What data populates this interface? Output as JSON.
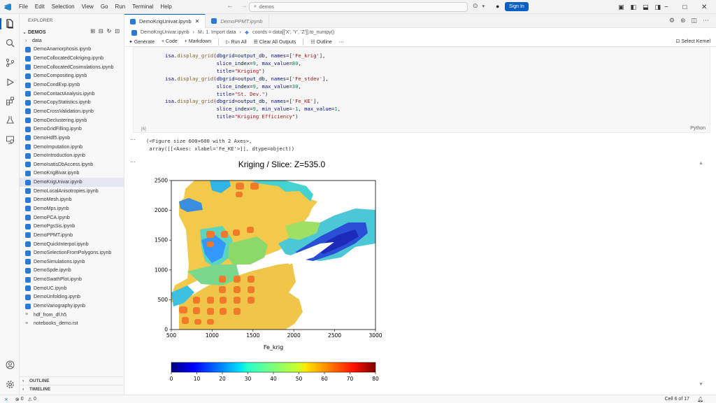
{
  "menu": [
    "File",
    "Edit",
    "Selection",
    "View",
    "Go",
    "Run",
    "Terminal",
    "Help"
  ],
  "search": {
    "text": "demos"
  },
  "account": {
    "sign_in": "Sign In"
  },
  "explorer": {
    "title": "EXPLORER",
    "root": "DEMOS",
    "folders": [
      "data"
    ],
    "notebooks": [
      "DemoAnamorphosis.ipynb",
      "DemoCollocatedCokriging.ipynb",
      "DemoCollocatedCosimulations.ipynb",
      "DemoCompositing.ipynb",
      "DemoCondExp.ipynb",
      "DemoContactAnalysis.ipynb",
      "DemoCopyStatistics.ipynb",
      "DemoCrossValidation.ipynb",
      "DemoDeclustering.ipynb",
      "DemoGridFilling.ipynb",
      "DemoHdf5.ipynb",
      "DemoImputation.ipynb",
      "DemoIntroduction.ipynb",
      "DemoIsatisDbAccess.ipynb",
      "DemoKrigBivar.ipynb",
      "DemoKrigUnivar.ipynb",
      "DemoLocalAnisotropies.ipynb",
      "DemoMesh.ipynb",
      "DemoMps.ipynb",
      "DemoPCA.ipynb",
      "DemoPgsSis.ipynb",
      "DemoPPMT.ipynb",
      "DemoQuickInterpol.ipynb",
      "DemoSelectionFromPolygons.ipynb",
      "DemoSimulations.ipynb",
      "DemoSpde.ipynb",
      "DemoSwathPlot.ipynb",
      "DemoUC.ipynb",
      "DemoUnfolding.ipynb",
      "DemoVariography.ipynb"
    ],
    "selected": "DemoKrigUnivar.ipynb",
    "files": [
      "hdf_from_df.h5",
      "notebooks_demo.rst"
    ],
    "outline": "OUTLINE",
    "timeline": "TIMELINE"
  },
  "tabs": [
    {
      "label": "DemoKrigUnivar.ipynb",
      "active": true
    },
    {
      "label": "DemoPPMT.ipynb",
      "active": false
    }
  ],
  "breadcrumb": [
    "DemoKrigUnivar.ipynb",
    "M↓ 1. Import data",
    "coords = data[['X', 'Y', 'Z']].to_numpy()"
  ],
  "toolbar": {
    "generate": "Generate",
    "code": "Code",
    "markdown": "Markdown",
    "run_all": "Run All",
    "clear_all": "Clear All Outputs",
    "outline": "Outline",
    "select_kernel": "Select Kernel"
  },
  "cell": {
    "exec_count": "[6]",
    "language": "Python"
  },
  "output_text": "(<Figure size 600×600 with 2 Axes>,\n array([[<Axes: xlabel='Fe_KE'>]], dtype=object))",
  "chart_data": {
    "type": "heatmap",
    "title": "Kriging / Slice: Z=535.0",
    "xlabel": "Fe_krig",
    "ylabel": "",
    "xlim": [
      500,
      3000
    ],
    "ylim": [
      0,
      2500
    ],
    "x_ticks": [
      "500",
      "1000",
      "1500",
      "2000",
      "2500",
      "3000"
    ],
    "y_ticks": [
      "0",
      "500",
      "1000",
      "1500",
      "2000",
      "2500"
    ],
    "colorbar": {
      "range": [
        0,
        80
      ],
      "ticks": [
        "0",
        "10",
        "20",
        "30",
        "40",
        "50",
        "60",
        "70",
        "80"
      ]
    },
    "colormap": "jet"
  },
  "status": {
    "errors": "0",
    "warnings": "0",
    "cell": "Cell 6 of 17"
  },
  "colors": {
    "accent": "#0a5fc4",
    "background": "#ffffff"
  }
}
